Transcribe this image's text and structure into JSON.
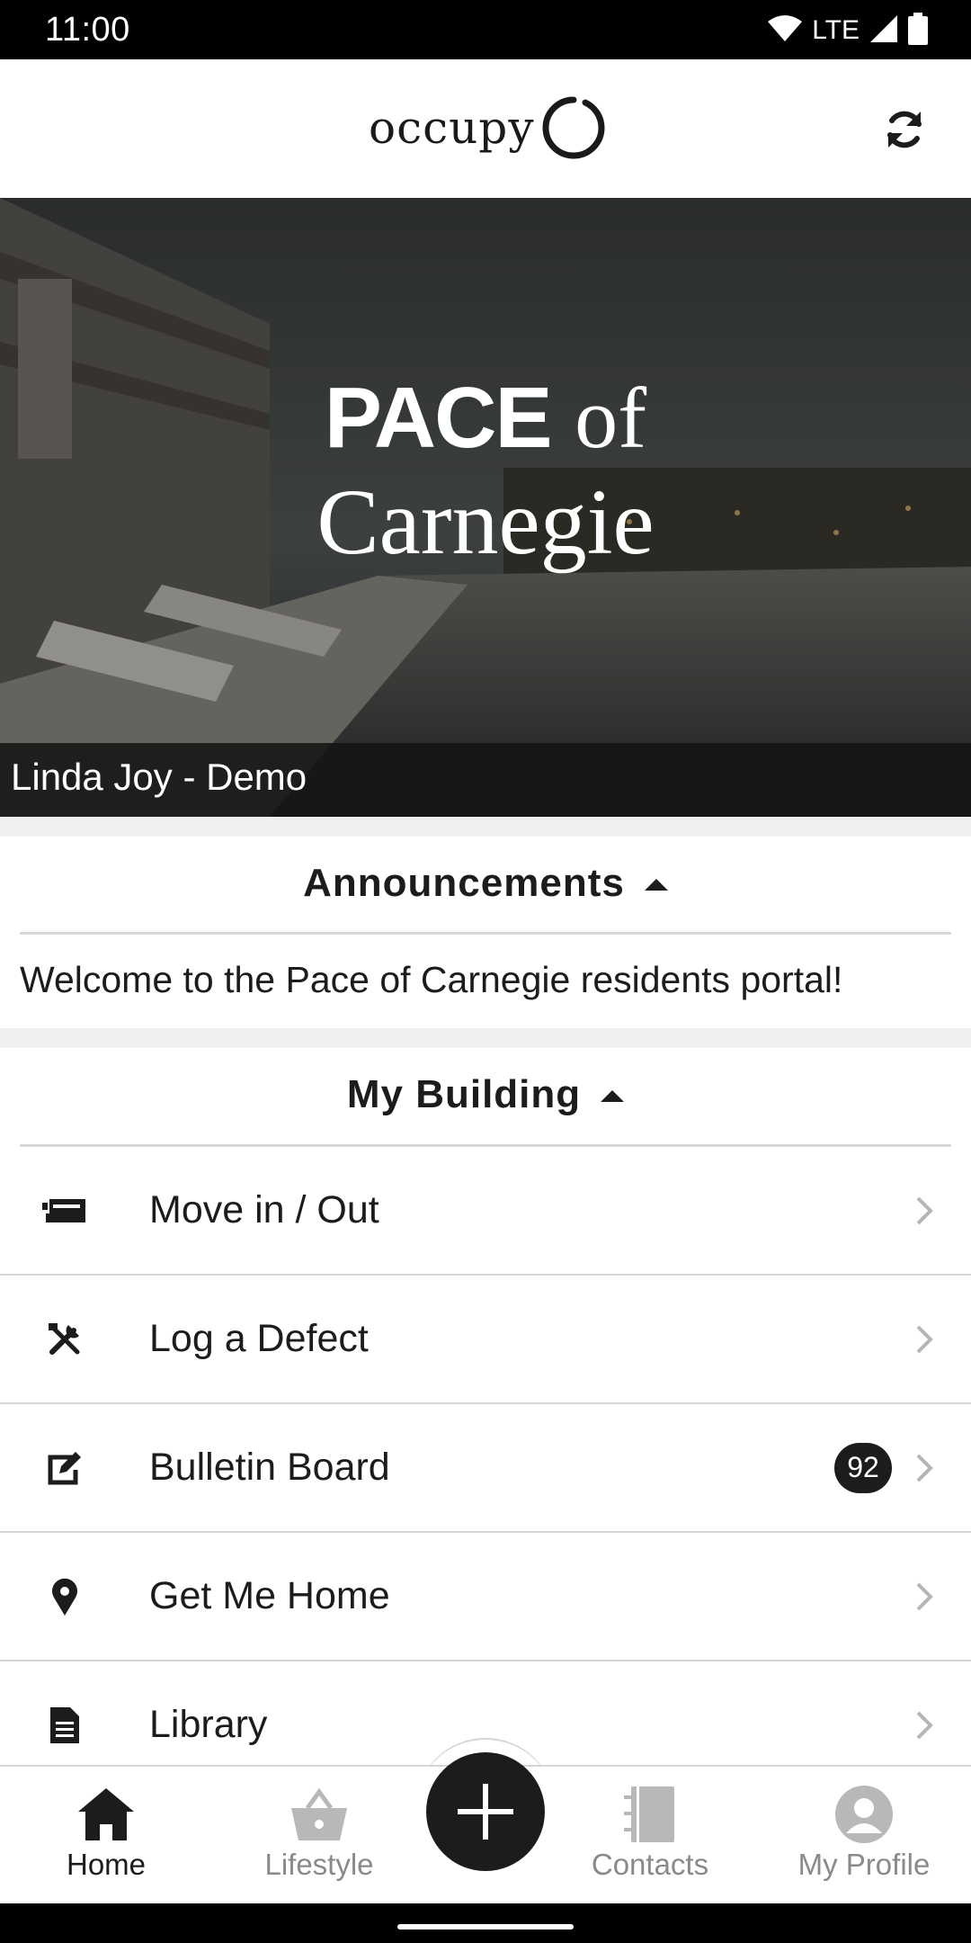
{
  "status_bar": {
    "time": "11:00",
    "network": "LTE",
    "icons": [
      "wifi-icon",
      "signal-icon",
      "battery-icon"
    ]
  },
  "app_bar": {
    "logo_text": "occupy",
    "logo_icon": "occupy-ring-logo",
    "refresh_icon": "refresh-icon"
  },
  "hero": {
    "title_strong": "PACE",
    "title_light": "of",
    "title_line2": "Carnegie",
    "caption": "Linda Joy - Demo"
  },
  "announcements": {
    "header": "Announcements",
    "text": "Welcome to the Pace of Carnegie residents portal!"
  },
  "my_building": {
    "header": "My Building",
    "items": [
      {
        "label": "Move in / Out",
        "icon": "truck-icon"
      },
      {
        "label": "Log a Defect",
        "icon": "tools-icon"
      },
      {
        "label": "Bulletin Board",
        "icon": "edit-icon",
        "badge": "92"
      },
      {
        "label": "Get Me Home",
        "icon": "map-pin-icon"
      },
      {
        "label": "Library",
        "icon": "document-icon"
      }
    ]
  },
  "bottom_nav": {
    "items": [
      {
        "label": "Home",
        "icon": "home-icon",
        "active": true
      },
      {
        "label": "Lifestyle",
        "icon": "basket-icon",
        "active": false
      },
      {
        "label": "Contacts",
        "icon": "contacts-book-icon",
        "active": false
      },
      {
        "label": "My Profile",
        "icon": "profile-icon",
        "active": false
      }
    ],
    "fab_icon": "plus-icon"
  },
  "colors": {
    "primary": "#1c1c1c",
    "inactive": "#8a8a8a",
    "divider": "#d6d6d6",
    "section_gap": "#efefef"
  }
}
